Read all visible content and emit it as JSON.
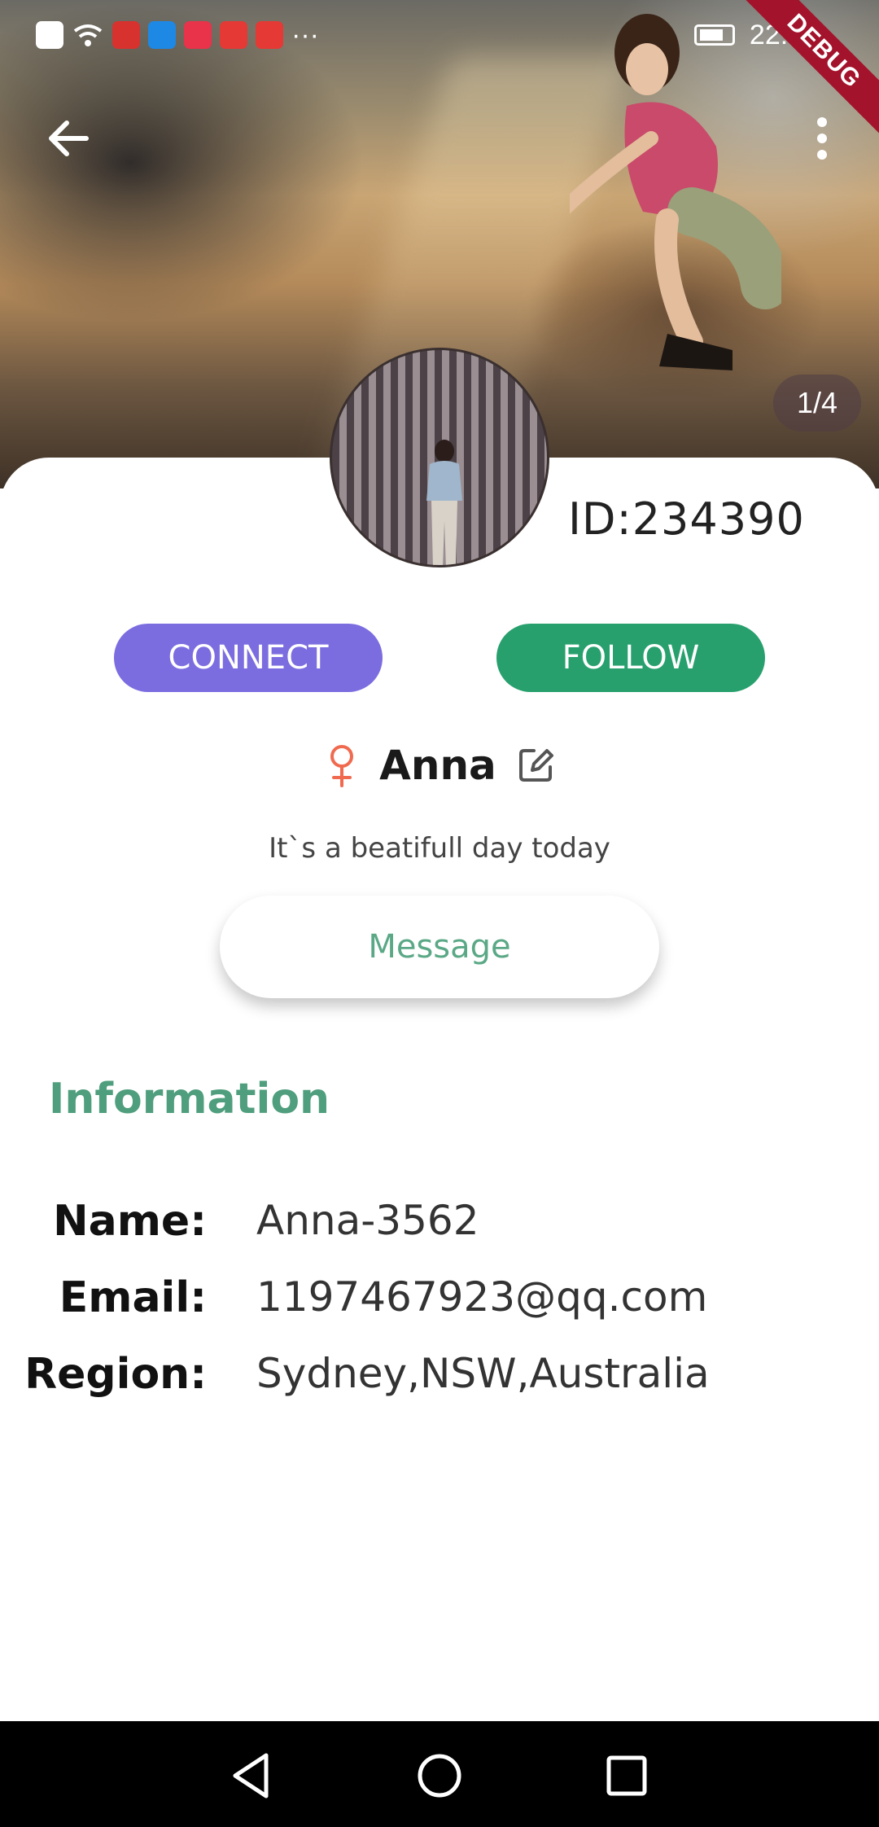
{
  "status_bar": {
    "overflow": "···",
    "time": "22:19",
    "icon_colors": [
      "#ffffff",
      "#ffffff",
      "#d8322f",
      "#1e88e5",
      "#e8334a",
      "#e53935",
      "#e53935"
    ]
  },
  "debug_banner": "DEBUG",
  "header": {
    "back_icon": "arrow-left-icon",
    "more_icon": "more-vertical-icon",
    "photo_counter": "1/4"
  },
  "profile": {
    "id_text": "ID:234390",
    "connect_label": "CONNECT",
    "follow_label": "FOLLOW",
    "gender_icon": "female-icon",
    "name": "Anna",
    "edit_icon": "edit-icon",
    "bio": "It`s a beatifull day today",
    "message_label": "Message"
  },
  "information": {
    "title": "Information",
    "rows": [
      {
        "label": "Name:",
        "value": "Anna-3562"
      },
      {
        "label": "Email:",
        "value": "1197467923@qq.com"
      },
      {
        "label": "Region:",
        "value": "Sydney,NSW,Australia"
      }
    ]
  },
  "nav_bar": {
    "back_icon": "triangle-back-icon",
    "home_icon": "circle-home-icon",
    "recents_icon": "square-recents-icon"
  },
  "colors": {
    "connect": "#7b6de0",
    "follow": "#27a06d",
    "accent_green": "#4f9e7d",
    "message_text": "#5aa886",
    "gender": "#f06a4f"
  }
}
